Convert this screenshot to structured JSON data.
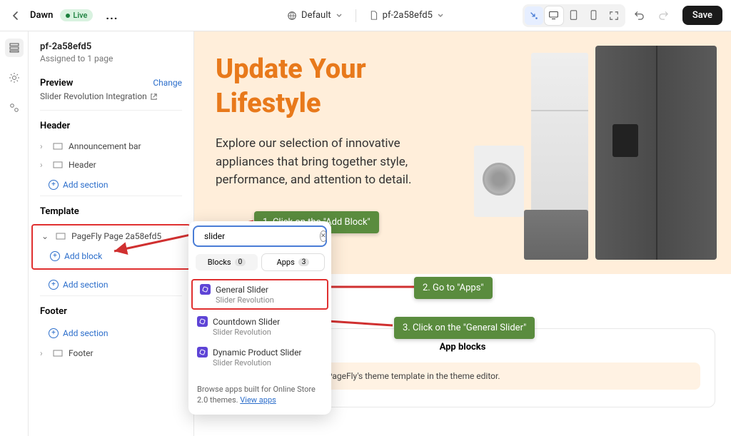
{
  "topbar": {
    "theme_name": "Dawn",
    "live_label": "Live",
    "more_label": "...",
    "default_view": "Default",
    "page_file": "pf-2a58efd5",
    "save_label": "Save"
  },
  "sidebar": {
    "page_title": "pf-2a58efd5",
    "assigned": "Assigned to 1 page",
    "preview_label": "Preview",
    "change_label": "Change",
    "preview_name": "Slider Revolution Integration",
    "header_label": "Header",
    "header_items": [
      "Announcement bar",
      "Header"
    ],
    "add_section": "Add section",
    "template_label": "Template",
    "template_item": "PageFly Page 2a58efd5",
    "add_block": "Add block",
    "footer_label": "Footer",
    "footer_item": "Footer"
  },
  "hero": {
    "title_line1": "Update Your",
    "title_line2": "Lifestyle",
    "text": "Explore our selection of innovative appliances that bring together style, performance, and attention to detail."
  },
  "callouts": {
    "c1": "1. Click on the \"Add Block\"",
    "c2": "2. Go to \"Apps\"",
    "c3": "3. Click on the \"General Slider\""
  },
  "popup": {
    "search_value": "slider",
    "tab_blocks": "Blocks",
    "tab_blocks_count": "0",
    "tab_apps": "Apps",
    "tab_apps_count": "3",
    "items": [
      {
        "name": "General Slider",
        "sub": "Slider Revolution"
      },
      {
        "name": "Countdown Slider",
        "sub": "Slider Revolution"
      },
      {
        "name": "Dynamic Product Slider",
        "sub": "Slider Revolution"
      }
    ],
    "foot_text": "Browse apps built for Online Store 2.0 themes. ",
    "foot_link": "View apps"
  },
  "app_blocks": {
    "title": "App blocks",
    "text": "for app blocks added to PageFly's theme template in the theme editor."
  }
}
